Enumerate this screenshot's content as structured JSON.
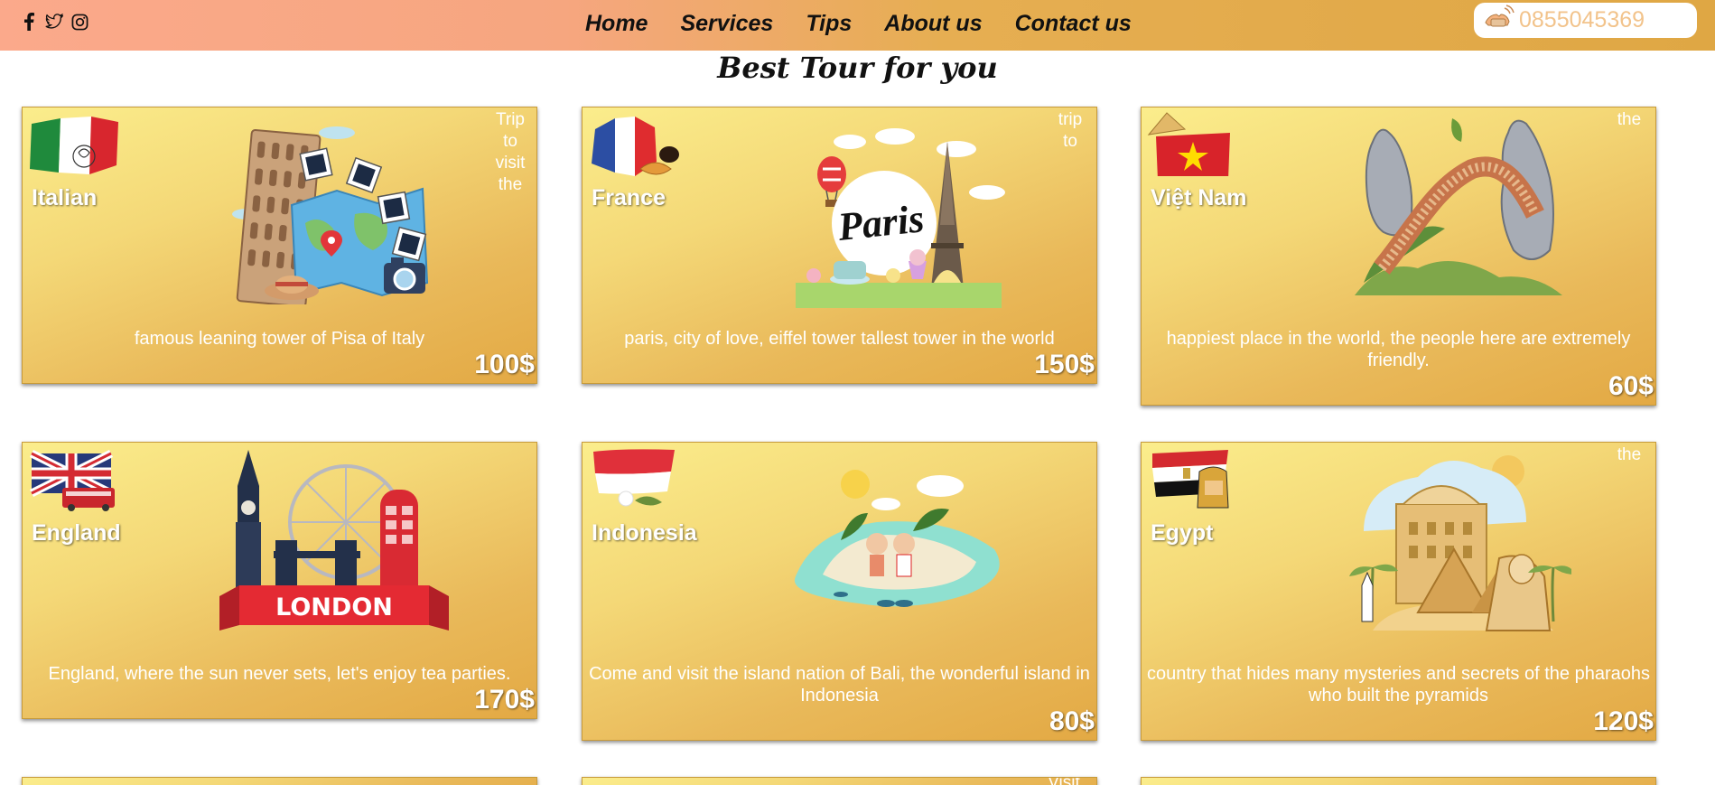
{
  "header": {
    "socials": [
      "facebook-icon",
      "twitter-icon",
      "instagram-icon"
    ],
    "nav": [
      "Home",
      "Services",
      "Tips",
      "About us",
      "Contact us"
    ],
    "phone": "0855045369"
  },
  "section_title": "Best Tour for you",
  "cards": [
    {
      "country": "Italian",
      "corner": [
        "Trip",
        "to",
        "visit",
        "the"
      ],
      "desc": "famous leaning tower of Pisa of Italy",
      "price": "100$"
    },
    {
      "country": "France",
      "corner": [
        "trip",
        "to"
      ],
      "desc": "paris, city of love, eiffel tower tallest tower in the world",
      "price": "150$"
    },
    {
      "country": "Việt Nam",
      "corner": [
        "the"
      ],
      "desc": "happiest place in the world, the people here are extremely friendly.",
      "price": "60$"
    },
    {
      "country": "England",
      "corner": [],
      "desc": "England, where the sun never sets, let's enjoy tea parties.",
      "price": "170$"
    },
    {
      "country": "Indonesia",
      "corner": [],
      "desc": "Come and visit the island nation of Bali, the wonderful island in Indonesia",
      "price": "80$"
    },
    {
      "country": "Egypt",
      "corner": [
        "the"
      ],
      "desc": "country that hides many mysteries and secrets of the pharaohs who built the pyramids",
      "price": "120$"
    }
  ],
  "illustrations": [
    "pisa-tower-map-illustration",
    "paris-eiffel-illustration",
    "golden-bridge-illustration",
    "london-bigben-illustration",
    "bali-island-illustration",
    "egypt-pyramids-illustration"
  ],
  "next_row_corner": "Visit"
}
